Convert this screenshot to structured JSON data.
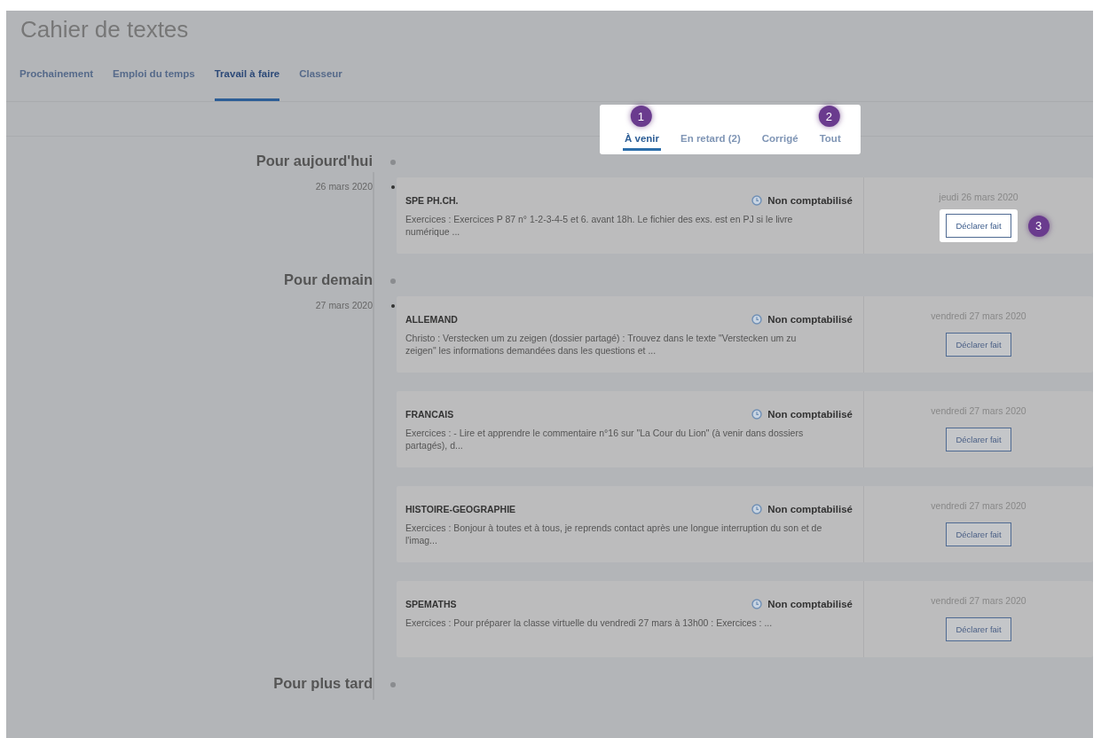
{
  "title": "Cahier de textes",
  "tabs": [
    {
      "label": "Prochainement",
      "selected": false
    },
    {
      "label": "Emploi du temps",
      "selected": false
    },
    {
      "label": "Travail à faire",
      "selected": true
    },
    {
      "label": "Classeur",
      "selected": false
    }
  ],
  "filters": {
    "spotlight": true,
    "items": [
      {
        "label": "À venir",
        "selected": true,
        "badge": "1"
      },
      {
        "label": "En retard (2)",
        "selected": false
      },
      {
        "label": "Corrigé",
        "selected": false
      },
      {
        "label": "Tout",
        "selected": false,
        "badge": "2"
      }
    ]
  },
  "groups": [
    {
      "heading": "Pour aujourd'hui",
      "dates": [
        {
          "date": "26 mars 2020",
          "entries": [
            {
              "subject": "SPE PH.CH.",
              "status": "Non comptabilisé",
              "description": "Exercices : Exercices P 87 n° 1-2-3-4-5 et 6. avant 18h. Le fichier des exs. est en PJ si le livre numérique ...",
              "due": "jeudi 26 mars 2020",
              "button": "Déclarer fait",
              "spotlight": true,
              "badge": "3"
            }
          ]
        }
      ]
    },
    {
      "heading": "Pour demain",
      "dates": [
        {
          "date": "27 mars 2020",
          "entries": [
            {
              "subject": "ALLEMAND",
              "status": "Non comptabilisé",
              "description": "Christo : Verstecken um zu zeigen (dossier partagé) : Trouvez dans le texte \"Verstecken um zu zeigen\" les informations demandées dans les questions et ...",
              "due": "vendredi 27 mars 2020",
              "button": "Déclarer fait",
              "spotlight": false
            },
            {
              "subject": "FRANCAIS",
              "status": "Non comptabilisé",
              "description": "Exercices : - Lire et apprendre le commentaire n°16 sur \"La Cour du Lion\" (à venir dans dossiers partagés), d...",
              "due": "vendredi 27 mars 2020",
              "button": "Déclarer fait",
              "spotlight": false
            },
            {
              "subject": "HISTOIRE-GEOGRAPHIE",
              "status": "Non comptabilisé",
              "description": "Exercices : Bonjour à toutes et à tous, je reprends contact après une longue interruption du son et de l'imag...",
              "due": "vendredi 27 mars 2020",
              "button": "Déclarer fait",
              "spotlight": false
            },
            {
              "subject": "SPEMATHS",
              "status": "Non comptabilisé",
              "description": "Exercices : Pour préparer la classe virtuelle du vendredi 27 mars à 13h00 : Exercices : ...",
              "due": "vendredi 27 mars 2020",
              "button": "Déclarer fait",
              "spotlight": false
            }
          ]
        }
      ]
    },
    {
      "heading": "Pour plus tard"
    }
  ]
}
